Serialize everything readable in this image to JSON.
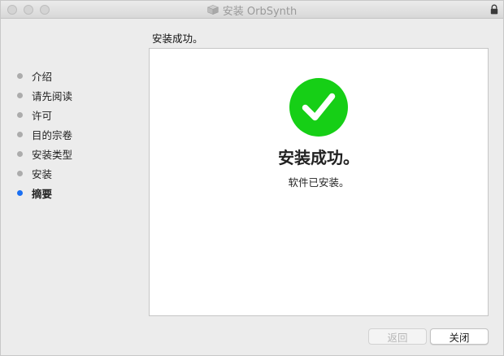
{
  "window": {
    "title": "安装 OrbSynth"
  },
  "sidebar": {
    "steps": [
      {
        "label": "介绍",
        "active": false
      },
      {
        "label": "请先阅读",
        "active": false
      },
      {
        "label": "许可",
        "active": false
      },
      {
        "label": "目的宗卷",
        "active": false
      },
      {
        "label": "安装类型",
        "active": false
      },
      {
        "label": "安装",
        "active": false
      },
      {
        "label": "摘要",
        "active": true
      }
    ]
  },
  "main": {
    "heading": "安装成功。",
    "success_title": "安装成功。",
    "success_subtitle": "软件已安装。"
  },
  "buttons": {
    "back_label": "返回",
    "close_label": "关闭"
  },
  "colors": {
    "success_green": "#16cf16",
    "active_step": "#1a6ff2",
    "inactive_step": "#acacac"
  },
  "icons": {
    "title_icon": "package-icon",
    "lock_icon": "lock-icon",
    "success_icon": "checkmark-circle-icon"
  }
}
